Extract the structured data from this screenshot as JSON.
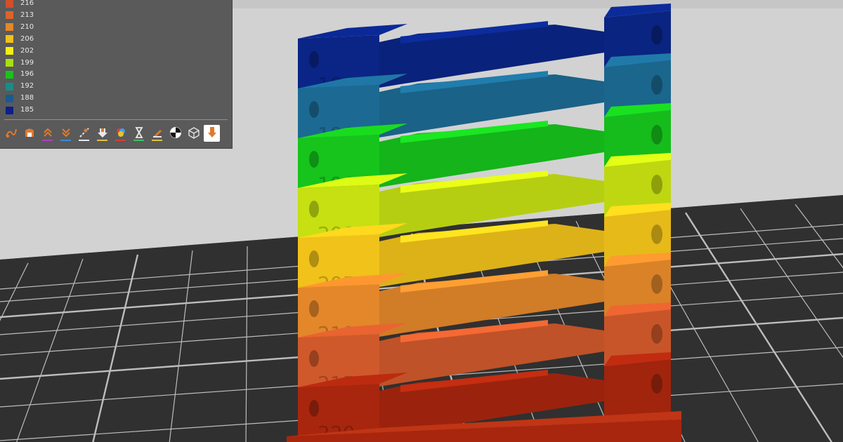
{
  "legend": {
    "items": [
      {
        "label": "216",
        "color": "#d0502a"
      },
      {
        "label": "213",
        "color": "#d8642e"
      },
      {
        "label": "210",
        "color": "#e3872a"
      },
      {
        "label": "206",
        "color": "#f0c21a"
      },
      {
        "label": "202",
        "color": "#f8ef10"
      },
      {
        "label": "199",
        "color": "#a8e010"
      },
      {
        "label": "196",
        "color": "#16c41c"
      },
      {
        "label": "192",
        "color": "#1a8c8a"
      },
      {
        "label": "188",
        "color": "#1a5a90"
      },
      {
        "label": "185",
        "color": "#0c1f8a"
      }
    ]
  },
  "toolbar": {
    "tools": [
      {
        "icon": "travel-icon",
        "underline": ""
      },
      {
        "icon": "wipe-icon",
        "underline": ""
      },
      {
        "icon": "retractions-icon",
        "underline": "#b040c0"
      },
      {
        "icon": "deretractions-icon",
        "underline": "#3a8ad8"
      },
      {
        "icon": "seams-icon",
        "underline": "#e8e8e8"
      },
      {
        "icon": "tool-changes-icon",
        "underline": "#e0c040"
      },
      {
        "icon": "color-changes-icon",
        "underline": "#d04040"
      },
      {
        "icon": "pause-prints-icon",
        "underline": "#40c060"
      },
      {
        "icon": "custom-gcode-icon",
        "underline": "#e0c040"
      },
      {
        "icon": "center-of-gravity-icon",
        "underline": ""
      },
      {
        "icon": "shells-icon",
        "underline": ""
      },
      {
        "icon": "tool-marker-icon",
        "underline": ""
      }
    ]
  },
  "model": {
    "tier_labels": [
      "185",
      "190",
      "196",
      "200",
      "205",
      "210",
      "215",
      "220"
    ],
    "tier_colors": [
      "#0a2586",
      "#1c6a93",
      "#16c41c",
      "#c6e012",
      "#f0c21a",
      "#e3872a",
      "#d0592b",
      "#a8260e"
    ]
  }
}
